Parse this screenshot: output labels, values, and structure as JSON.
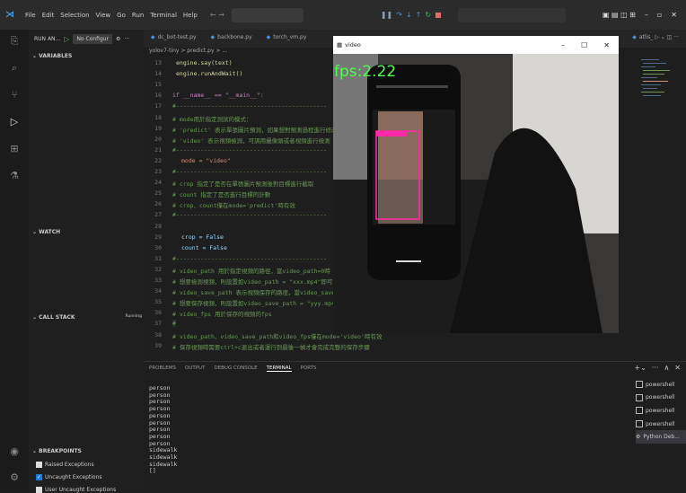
{
  "menu": [
    "File",
    "Edit",
    "Selection",
    "View",
    "Go",
    "Run",
    "Terminal",
    "Help"
  ],
  "sidebar": {
    "run_label": "RUN AN...",
    "config": "No Configur",
    "sections": {
      "variables": "VARIABLES",
      "watch": "WATCH",
      "callstack": "CALL STACK",
      "callstack_state": "Running",
      "breakpoints": "BREAKPOINTS"
    },
    "breakpoints": [
      "Raised Exceptions",
      "Uncaught Exceptions",
      "User Uncaught Exceptions"
    ]
  },
  "tabs": [
    "dc_bot-test.py",
    "backbone.py",
    "torch_vm.py",
    "atlis_"
  ],
  "breadcrumb": "yolov7-tiny > predict.py > ...",
  "code": [
    {
      "n": "13",
      "t": "engine.say(text)"
    },
    {
      "n": "14",
      "t": "engine.runAndWait()"
    },
    {
      "n": "15",
      "t": ""
    },
    {
      "n": "16",
      "t": "if __name__ == \"__main__\":"
    },
    {
      "n": "17",
      "t": "#-------------------------------------------"
    },
    {
      "n": "18",
      "t": "# mode用於指定測試的模式："
    },
    {
      "n": "19",
      "t": "# 'predict' 表示單張圖片預測，如果想對預測過程進行修改"
    },
    {
      "n": "20",
      "t": "# 'video' 表示視頻檢測，可調用攝像頭或者視頻進行檢測"
    },
    {
      "n": "21",
      "t": "#-------------------------------------------"
    },
    {
      "n": "22",
      "t": "mode = \"video\""
    },
    {
      "n": "23",
      "t": "#-------------------------------------------"
    },
    {
      "n": "24",
      "t": "# crop 指定了是否在單張圖片預測後對目標進行截取"
    },
    {
      "n": "25",
      "t": "# count 指定了是否進行目標的計數"
    },
    {
      "n": "26",
      "t": "# crop、count僅在mode='predict'時有效"
    },
    {
      "n": "27",
      "t": "#-------------------------------------------"
    },
    {
      "n": "28",
      "t": ""
    },
    {
      "n": "29",
      "t": "crop = False"
    },
    {
      "n": "30",
      "t": "count = False"
    },
    {
      "n": "31",
      "t": "#-------------------------------------------"
    },
    {
      "n": "32",
      "t": "# video_path 用於指定視頻的路徑，當video_path=0時"
    },
    {
      "n": "33",
      "t": "# 想要檢測視頻，則設置如video_path = \"xxx.mp4\"即可"
    },
    {
      "n": "34",
      "t": "# video_save_path 表示視頻保存的路徑，當video_save"
    },
    {
      "n": "35",
      "t": "# 想要保存視頻，則設置如video_save_path = \"yyy.mp4\""
    },
    {
      "n": "36",
      "t": "# video_fps 用於保存的視頻的fps"
    },
    {
      "n": "37",
      "t": "#"
    },
    {
      "n": "38",
      "t": "# video_path、video_save_path和video_fps僅在mode='video'時有效"
    },
    {
      "n": "39",
      "t": "# 保存視頻時需要ctrl+c退出或者運行到最後一幀才會完成完整的保存步驟"
    }
  ],
  "panel_tabs": [
    "PROBLEMS",
    "OUTPUT",
    "DEBUG CONSOLE",
    "TERMINAL",
    "PORTS"
  ],
  "terminal_lines": [
    "person",
    "person",
    "person",
    "person",
    "person",
    "person",
    "person",
    "person",
    "person",
    "sidewalk",
    "sidewalk",
    "sidewalk",
    "[]"
  ],
  "terminals": [
    "powershell",
    "powershell",
    "powershell",
    "powershell",
    "Python Deb..."
  ],
  "video": {
    "title": "video",
    "fps": "fps:2.22"
  }
}
